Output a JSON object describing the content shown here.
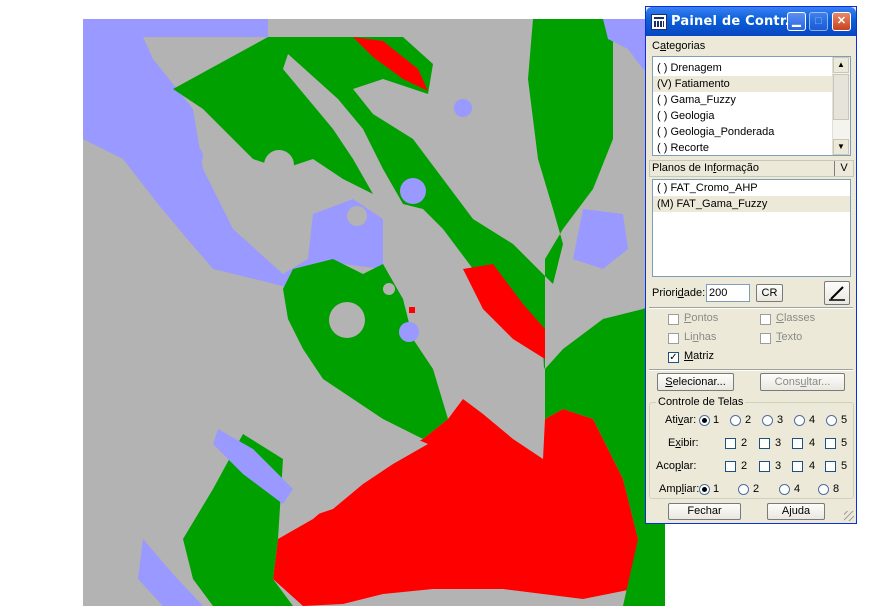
{
  "panel": {
    "title": "Painel de Contr...",
    "categorias": {
      "label_pre": "C",
      "label_ul": "a",
      "label_post": "tegorias",
      "items": [
        "( ) Drenagem",
        "(V) Fatiamento",
        "( ) Gama_Fuzzy",
        "( ) Geologia",
        "( ) Geologia_Ponderada",
        "( ) Recorte"
      ],
      "selected_index": 1
    },
    "planos": {
      "label_pre": "Planos de In",
      "label_ul": "f",
      "label_post": "ormação",
      "v_label": "V",
      "items": [
        "( ) FAT_Cromo_AHP",
        "(M) FAT_Gama_Fuzzy"
      ],
      "selected_index": 1
    },
    "prioridade": {
      "label_pre": "Priori",
      "label_ul": "d",
      "label_post": "ade:",
      "value": "200",
      "cr_label": "CR"
    },
    "representacoes": {
      "pontos": {
        "pre": "",
        "ul": "P",
        "post": "ontos",
        "checked": false,
        "enabled": false
      },
      "classes": {
        "pre": "",
        "ul": "C",
        "post": "lasses",
        "checked": false,
        "enabled": false
      },
      "linhas": {
        "pre": "Li",
        "ul": "n",
        "post": "has",
        "checked": false,
        "enabled": false
      },
      "texto": {
        "pre": "",
        "ul": "T",
        "post": "exto",
        "checked": false,
        "enabled": false
      },
      "matriz": {
        "pre": "",
        "ul": "M",
        "post": "atriz",
        "checked": true,
        "enabled": true
      }
    },
    "selecionar": {
      "pre": "",
      "ul": "S",
      "post": "elecionar..."
    },
    "consultar": {
      "pre": "Cons",
      "ul": "u",
      "post": "ltar..."
    },
    "controle_telas": {
      "title": "Controle de Telas",
      "ativar": {
        "pre": "Ati",
        "ul": "v",
        "post": "ar:",
        "options": [
          "1",
          "2",
          "3",
          "4",
          "5"
        ],
        "selected": "1"
      },
      "exibir": {
        "pre": "E",
        "ul": "x",
        "post": "ibir:",
        "options": [
          "2",
          "3",
          "4",
          "5"
        ]
      },
      "acoplar": {
        "pre": "Aco",
        "ul": "p",
        "post": "lar:",
        "options": [
          "2",
          "3",
          "4",
          "5"
        ]
      },
      "ampliar": {
        "pre": "Amp",
        "ul": "l",
        "post": "iar:",
        "options": [
          "1",
          "2",
          "4",
          "8"
        ],
        "selected": "1"
      }
    },
    "fechar": "Fechar",
    "ajuda": "Ajuda"
  },
  "map_colors": {
    "gray": "#b3b3b3",
    "green": "#00a000",
    "red": "#ff0000",
    "lavender": "#9999ff"
  }
}
